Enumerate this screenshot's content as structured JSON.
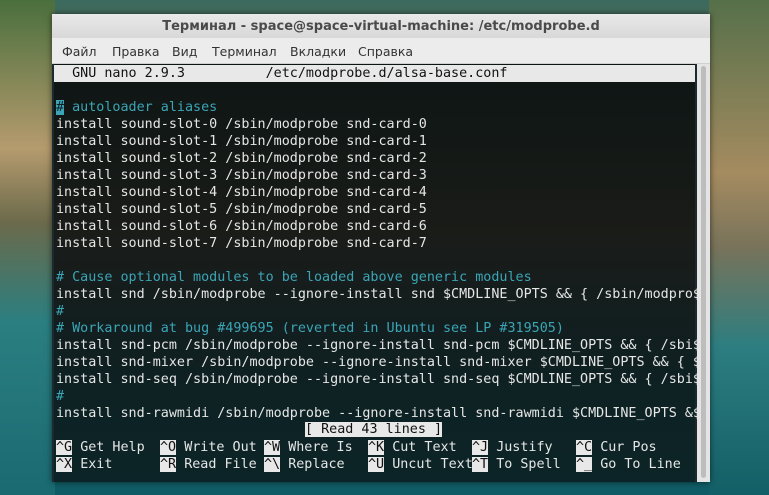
{
  "window": {
    "title": "Терминал - space@space-virtual-machine: /etc/modprobe.d"
  },
  "menu": [
    "Файл",
    "Правка",
    "Вид",
    "Терминал",
    "Вкладки",
    "Справка"
  ],
  "nano": {
    "header": "  GNU nano 2.9.3          /etc/modprobe.d/alsa-base.conf",
    "lines": [
      {
        "text": "",
        "type": "normal"
      },
      {
        "text": "# autoloader aliases",
        "type": "comment"
      },
      {
        "text": "install sound-slot-0 /sbin/modprobe snd-card-0",
        "type": "normal"
      },
      {
        "text": "install sound-slot-1 /sbin/modprobe snd-card-1",
        "type": "normal"
      },
      {
        "text": "install sound-slot-2 /sbin/modprobe snd-card-2",
        "type": "normal"
      },
      {
        "text": "install sound-slot-3 /sbin/modprobe snd-card-3",
        "type": "normal"
      },
      {
        "text": "install sound-slot-4 /sbin/modprobe snd-card-4",
        "type": "normal"
      },
      {
        "text": "install sound-slot-5 /sbin/modprobe snd-card-5",
        "type": "normal"
      },
      {
        "text": "install sound-slot-6 /sbin/modprobe snd-card-6",
        "type": "normal"
      },
      {
        "text": "install sound-slot-7 /sbin/modprobe snd-card-7",
        "type": "normal"
      },
      {
        "text": "",
        "type": "normal"
      },
      {
        "text": "# Cause optional modules to be loaded above generic modules",
        "type": "comment"
      },
      {
        "text": "install snd /sbin/modprobe --ignore-install snd $CMDLINE_OPTS && { /sbin/modpro$",
        "type": "normal"
      },
      {
        "text": "#",
        "type": "comment"
      },
      {
        "text": "# Workaround at bug #499695 (reverted in Ubuntu see LP #319505)",
        "type": "comment"
      },
      {
        "text": "install snd-pcm /sbin/modprobe --ignore-install snd-pcm $CMDLINE_OPTS && { /sbi$",
        "type": "normal"
      },
      {
        "text": "install snd-mixer /sbin/modprobe --ignore-install snd-mixer $CMDLINE_OPTS && { $",
        "type": "normal"
      },
      {
        "text": "install snd-seq /sbin/modprobe --ignore-install snd-seq $CMDLINE_OPTS && { /sbi$",
        "type": "normal"
      },
      {
        "text": "#",
        "type": "comment"
      },
      {
        "text": "install snd-rawmidi /sbin/modprobe --ignore-install snd-rawmidi $CMDLINE_OPTS &$",
        "type": "normal"
      }
    ],
    "status": "[ Read 43 lines ]",
    "shortcuts_row1": [
      {
        "key": "^G",
        "label": "Get Help"
      },
      {
        "key": "^O",
        "label": "Write Out"
      },
      {
        "key": "^W",
        "label": "Where Is"
      },
      {
        "key": "^K",
        "label": "Cut Text"
      },
      {
        "key": "^J",
        "label": "Justify"
      },
      {
        "key": "^C",
        "label": "Cur Pos"
      }
    ],
    "shortcuts_row2": [
      {
        "key": "^X",
        "label": "Exit"
      },
      {
        "key": "^R",
        "label": "Read File"
      },
      {
        "key": "^\\",
        "label": "Replace"
      },
      {
        "key": "^U",
        "label": "Uncut Text"
      },
      {
        "key": "^T",
        "label": "To Spell"
      },
      {
        "key": "^_",
        "label": "Go To Line"
      }
    ]
  }
}
